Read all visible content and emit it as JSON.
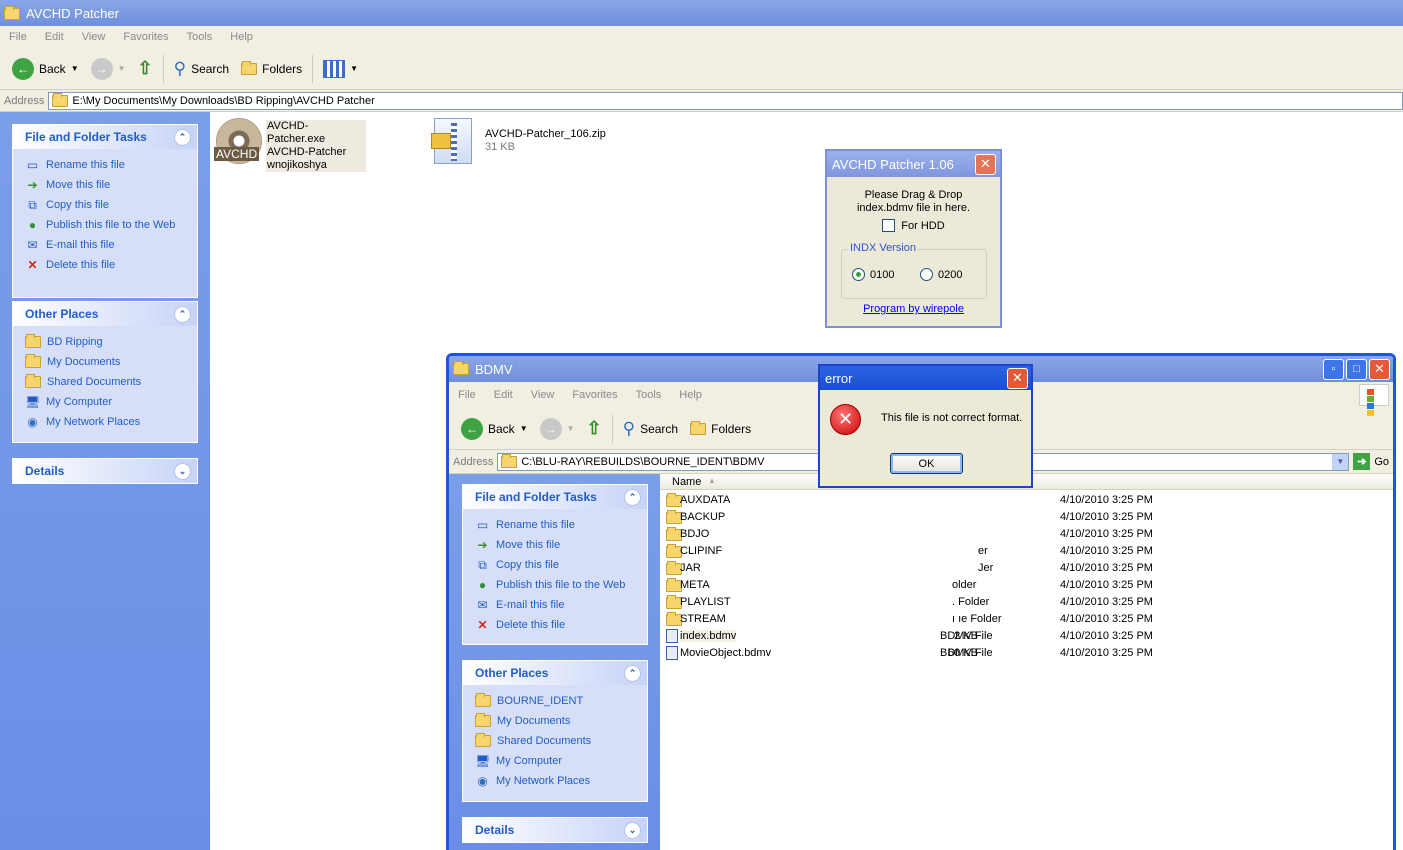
{
  "main": {
    "title": "AVCHD Patcher",
    "menu": [
      "File",
      "Edit",
      "View",
      "Favorites",
      "Tools",
      "Help"
    ],
    "toolbar": {
      "back": "Back",
      "search": "Search",
      "folders": "Folders"
    },
    "address_label": "Address",
    "address": "E:\\My Documents\\My Downloads\\BD Ripping\\AVCHD Patcher",
    "file_tasks": {
      "title": "File and Folder Tasks",
      "items": [
        "Rename this file",
        "Move this file",
        "Copy this file",
        "Publish this file to the Web",
        "E-mail this file",
        "Delete this file"
      ]
    },
    "other_places": {
      "title": "Other Places",
      "items": [
        "BD Ripping",
        "My Documents",
        "Shared Documents",
        "My Computer",
        "My Network Places"
      ]
    },
    "details": {
      "title": "Details"
    },
    "files": [
      {
        "name": "AVCHD-Patcher.exe",
        "line2": "AVCHD-Patcher",
        "line3": "wnojikoshya",
        "icon_text": "AVCHD"
      },
      {
        "name": "AVCHD-Patcher_106.zip",
        "line2": "31 KB"
      }
    ]
  },
  "patcher": {
    "title": "AVCHD Patcher 1.06",
    "instruction": [
      "Please Drag & Drop",
      "index.bdmv file in here."
    ],
    "for_hdd": "For HDD",
    "group": "INDX Version",
    "options": [
      "0100",
      "0200"
    ],
    "selected": "0100",
    "link": "Program by wirepole"
  },
  "bdmv": {
    "title": "BDMV",
    "menu": [
      "File",
      "Edit",
      "View",
      "Favorites",
      "Tools",
      "Help"
    ],
    "toolbar": {
      "back": "Back",
      "search": "Search",
      "folders": "Folders"
    },
    "address_label": "Address",
    "address": "C:\\BLU-RAY\\REBUILDS\\BOURNE_IDENT\\BDMV",
    "go": "Go",
    "file_tasks": {
      "title": "File and Folder Tasks",
      "items": [
        "Rename this file",
        "Move this file",
        "Copy this file",
        "Publish this file to the Web",
        "E-mail this file",
        "Delete this file"
      ]
    },
    "other_places": {
      "title": "Other Places",
      "items": [
        "BOURNE_IDENT",
        "My Documents",
        "Shared Documents",
        "My Computer",
        "My Network Places"
      ]
    },
    "details": {
      "title": "Details"
    },
    "column_name": "Name",
    "rows": [
      {
        "name": "AUXDATA",
        "size": "",
        "type": "",
        "date": "4/10/2010 3:25 PM",
        "kind": "folder"
      },
      {
        "name": "BACKUP",
        "size": "",
        "type": "",
        "date": "4/10/2010 3:25 PM",
        "kind": "folder"
      },
      {
        "name": "BDJO",
        "size": "",
        "type": "",
        "date": "4/10/2010 3:25 PM",
        "kind": "folder"
      },
      {
        "name": "CLIPINF",
        "size": "",
        "type": "er",
        "date": "4/10/2010 3:25 PM",
        "kind": "folder"
      },
      {
        "name": "JAR",
        "size": "",
        "type": "Jer",
        "date": "4/10/2010 3:25 PM",
        "kind": "folder"
      },
      {
        "name": "META",
        "size": "",
        "type": "older",
        "date": "4/10/2010 3:25 PM",
        "kind": "folder"
      },
      {
        "name": "PLAYLIST",
        "size": "",
        "type": ". Folder",
        "date": "4/10/2010 3:25 PM",
        "kind": "folder"
      },
      {
        "name": "STREAM",
        "size": "",
        "type": "ı ıe Folder",
        "date": "4/10/2010 3:25 PM",
        "kind": "folder"
      },
      {
        "name": "index.bdmv",
        "size": "2 KB",
        "type": "BDMV File",
        "date": "4/10/2010 3:25 PM",
        "kind": "file"
      },
      {
        "name": "MovieObject.bdmv",
        "size": "60 KB",
        "type": "BDMV File",
        "date": "4/10/2010 3:25 PM",
        "kind": "file"
      }
    ]
  },
  "error": {
    "title": "error",
    "message": "This file is not correct format.",
    "ok": "OK"
  }
}
